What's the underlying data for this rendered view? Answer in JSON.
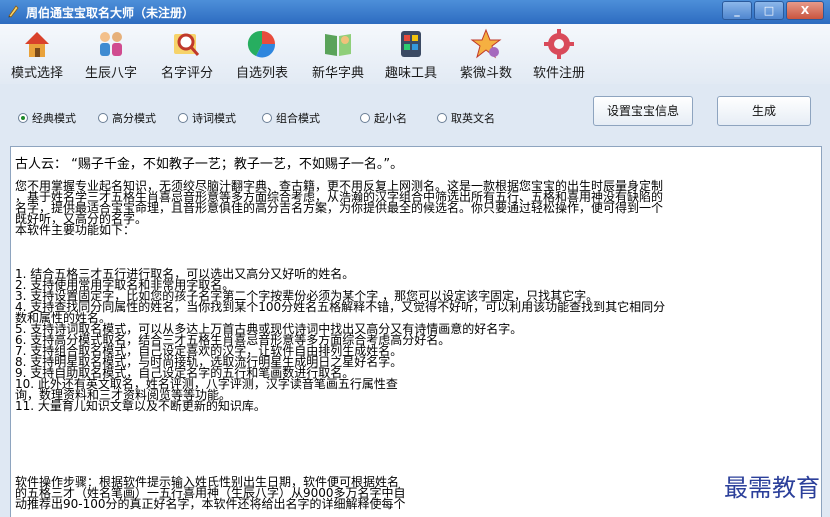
{
  "window": {
    "title": "周伯通宝宝取名大师（未注册）",
    "controls": [
      "_",
      "□",
      "X"
    ]
  },
  "toolbar": {
    "items": [
      {
        "label": "模式选择",
        "icon": "house-icon"
      },
      {
        "label": "生辰八字",
        "icon": "family-icon"
      },
      {
        "label": "名字评分",
        "icon": "magnifier-icon"
      },
      {
        "label": "自选列表",
        "icon": "pie-chart-icon"
      },
      {
        "label": "新华字典",
        "icon": "book-icon"
      },
      {
        "label": "趣味工具",
        "icon": "toolbox-icon"
      },
      {
        "label": "紫微斗数",
        "icon": "star-icon"
      },
      {
        "label": "软件注册",
        "icon": "gear-icon"
      }
    ]
  },
  "modes": {
    "options": [
      "经典模式",
      "高分模式",
      "诗词模式",
      "组合模式",
      "起小名",
      "取英文名"
    ],
    "selected": 0
  },
  "buttons": {
    "settings": "设置宝宝信息",
    "generate": "生成"
  },
  "content": {
    "quote": "古人云：  “赐子千金，不如教子一艺；教子一艺，不如赐子一名。”。",
    "intro": "您不用掌握专业起名知识，无须绞尽脑汁翻字典、查古籍，更不用反复上网测名。这是一款根据您宝宝的出生时辰量身定制\n，基于姓名学三才五格生肖喜忌音形意等多方面综合考虑，从浩瀚的汉字组合中筛选出所有五行、五格和喜用神没有缺陷的\n名字，提供最适合宝宝命理，且音形意俱佳的高分吉名方案，为你提供最全的候选名。你只要通过轻松操作，便可得到一个\n既好听，又高分的名字。\n本软件主要功能如下：",
    "features": "1. 结合五格三才五行进行取名，可以选出又高分又好听的姓名。\n2. 支持使用常用字取名和非常用字取名。\n3. 支持设置固定字，比如您的孩子名字第二个字按辈份必须为某个字 ，那您可以设定该字固定，只找其它字。\n4. 支持查找同分同属性的姓名，当你找到某个100分姓名五格解释不错，又觉得不好听，可以利用该功能查找到其它相同分\n数和属性的姓名。\n5. 支持诗词取名模式，可以从多达上万首古典或现代诗词中找出又高分又有诗情画意的好名字。\n6. 支持高分模式取名，结合三才五格生肖喜忌音形意等多方面综合考虑高分好名。\n7. 支持组合取名模式，自己设定喜欢的汉字，让软件自由排列生成姓名。\n8. 支持明星取名模式，与时尚接轨，选取流行明星生成明日之星好名字。\n9. 支持自助取名模式，自己设定名字的五行和笔画数进行取名。\n10. 此外还有英文取名，姓名评测，八字评测，汉字读音笔画五行属性查\n询，数理资料和三才资料阅览等等功能。\n11. 大量育儿知识文章以及不断更新的知识库。",
    "steps": "软件操作步骤：根据软件提示输入姓氏性别出生日期，软件便可根据姓名\n的五格三才（姓名笔画）一五行喜用神（生辰八字）从9000多万名字中自\n动推荐出90-100分的真正好名字，本软件还将给出名字的详细解释使每个"
  },
  "watermark": "最需教育",
  "colors": {
    "titlebar": "#2d6cc0",
    "watermark": "#2b3f9a",
    "radio_selected": "#1f8a2a"
  }
}
